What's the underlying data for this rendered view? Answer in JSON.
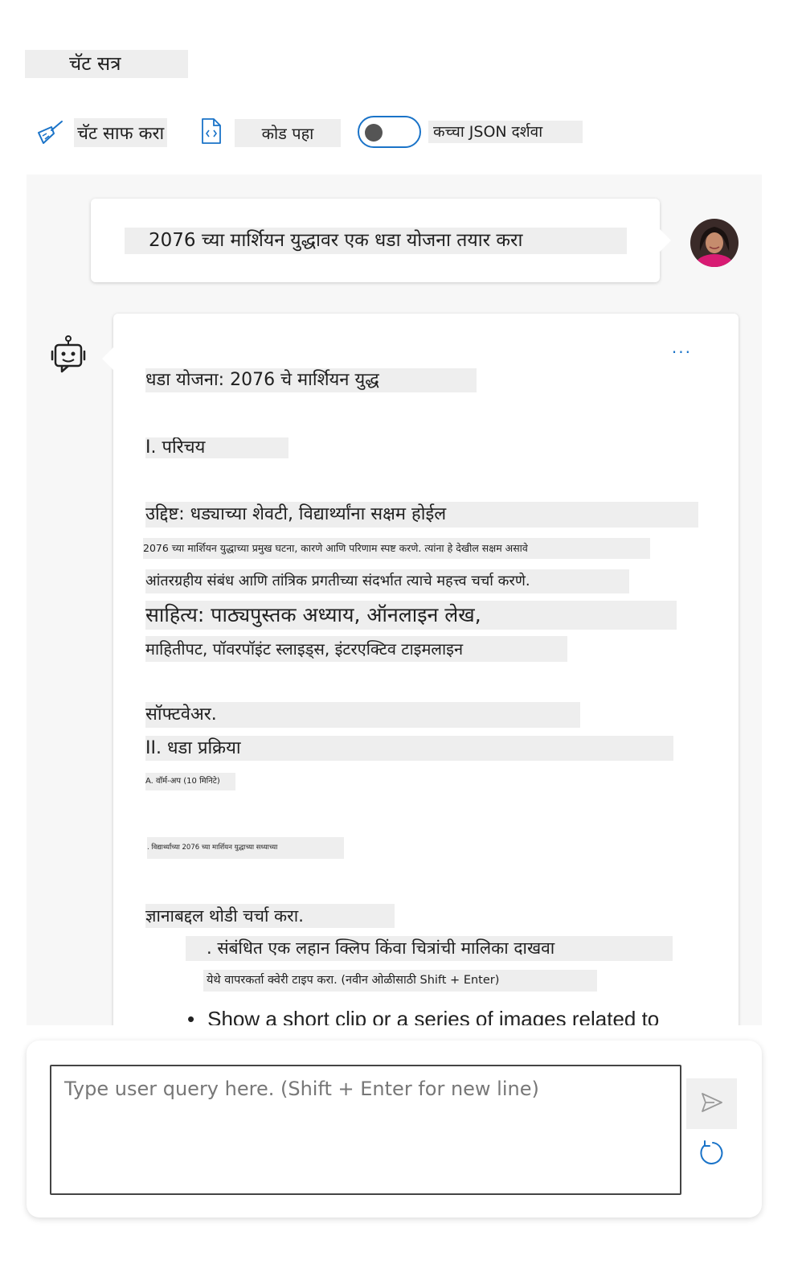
{
  "title": "चॅट सत्र",
  "toolbar": {
    "clear_label": "चॅट साफ करा",
    "code_label": "कोड पहा",
    "toggle_label": "कच्चा JSON दर्शवा",
    "raw_json_enabled": false
  },
  "colors": {
    "accent": "#1a73c8",
    "highlight": "#eeeeee",
    "chat_background": "#f7f7f7"
  },
  "user_message": {
    "text": "2076 च्या मार्शियन युद्धावर एक धडा योजना तयार करा"
  },
  "assistant_message": {
    "more_label": "...",
    "lines": [
      "धडा योजना: 2076 चे मार्शियन युद्ध",
      "I. परिचय",
      "उद्दिष्ट: धड्याच्या शेवटी, विद्यार्थ्यांना सक्षम होईल",
      "2076 च्या मार्शियन युद्धाच्या प्रमुख घटना, कारणे आणि परिणाम स्पष्ट करणे. त्यांना हे देखील सक्षम असावे",
      "आंतरग्रहीय संबंध आणि तांत्रिक प्रगतीच्या संदर्भात त्याचे महत्त्व चर्चा करणे.",
      "साहित्य: पाठ्यपुस्तक अध्याय, ऑनलाइन लेख,",
      "माहितीपट, पॉवरपॉइंट स्लाइड्स, इंटरएक्टिव टाइमलाइन",
      "सॉफ्टवेअर.",
      "II. धडा प्रक्रिया",
      "A. वॉर्म-अप (10 मिनिटे)",
      ". विद्यार्थ्यांच्या 2076 च्या मार्शियन युद्धाच्या सध्याच्या",
      "ज्ञानाबद्दल थोडी चर्चा करा.",
      ". संबंधित एक लहान क्लिप किंवा चित्रांची मालिका दाखवा",
      "येथे वापरकर्ता क्वेरी टाइप करा. (नवीन ओळीसाठी Shift + Enter)"
    ],
    "bullet_text": "Show a short clip or a series of images related to"
  },
  "composer": {
    "placeholder": "Type user query here. (Shift + Enter for new line)",
    "value": ""
  },
  "icons": {
    "clear": "broom-icon",
    "code": "code-file-icon",
    "send": "send-icon",
    "refresh": "refresh-icon",
    "bot": "bot-icon",
    "avatar": "user-avatar"
  }
}
